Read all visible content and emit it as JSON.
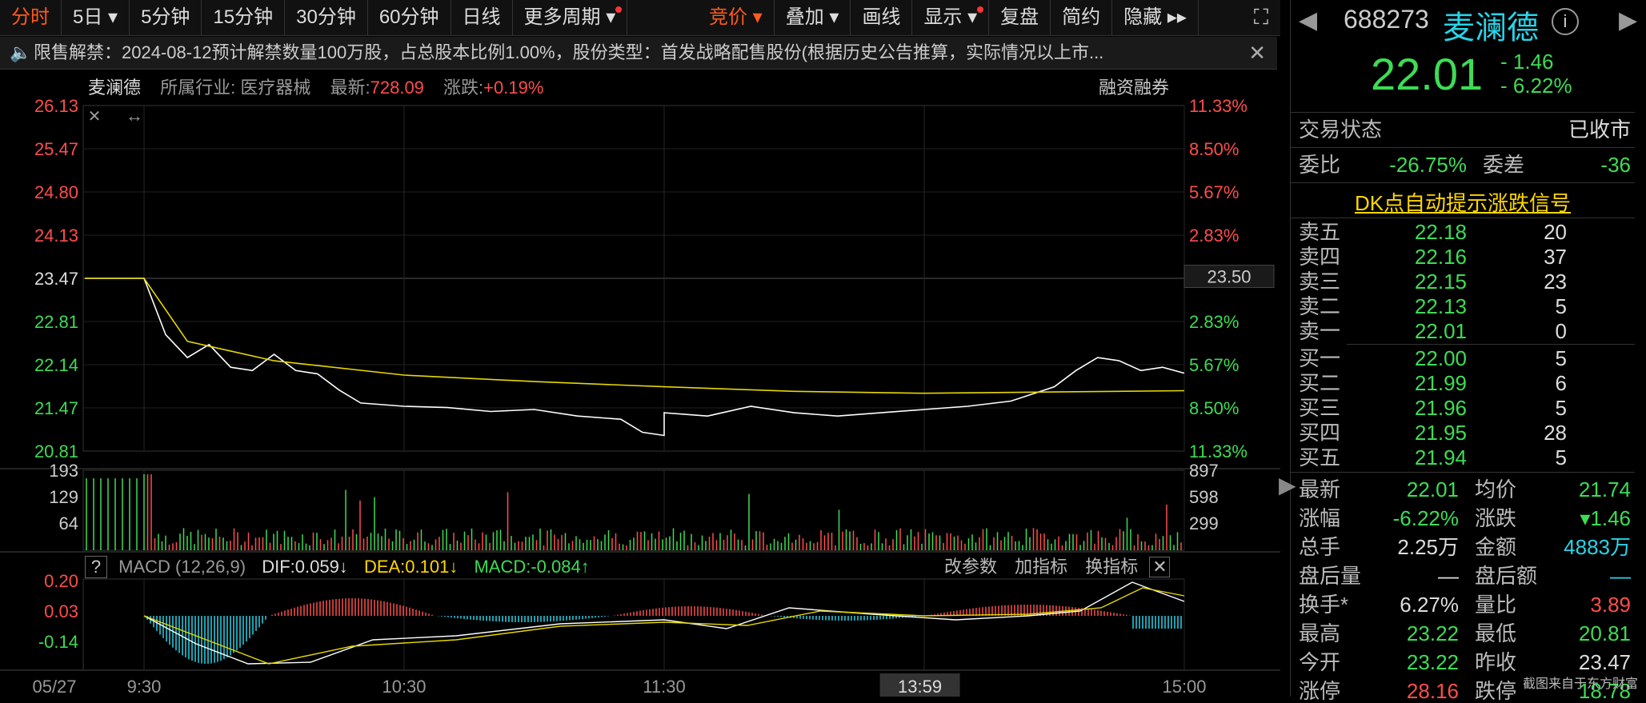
{
  "toolbar": {
    "left": [
      {
        "label": "分时",
        "active": true
      },
      {
        "label": "5日 ▾"
      },
      {
        "label": "5分钟"
      },
      {
        "label": "15分钟"
      },
      {
        "label": "30分钟"
      },
      {
        "label": "60分钟"
      },
      {
        "label": "日线"
      },
      {
        "label": "更多周期 ▾",
        "dot": true
      }
    ],
    "right": [
      {
        "label": "竞价 ▾",
        "active": true
      },
      {
        "label": "叠加 ▾"
      },
      {
        "label": "画线"
      },
      {
        "label": "显示 ▾",
        "dot": true
      },
      {
        "label": "复盘"
      },
      {
        "label": "简约"
      },
      {
        "label": "隐藏 ▸▸"
      }
    ]
  },
  "notice": {
    "text": "限售解禁：2024-08-12预计解禁数量100万股，占总股本比例1.00%，股份类型：首发战略配售股份(根据历史公告推算，实际情况以上市..."
  },
  "info": {
    "name": "麦澜德",
    "industry": "所属行业: 医疗器械",
    "latest_label": "最新:",
    "latest_value": "728.09",
    "change_label": "涨跌:",
    "change_value": "+0.19%",
    "margin": "融资融券"
  },
  "price_axis": {
    "left": [
      "26.13",
      "25.47",
      "24.80",
      "24.13",
      "23.47",
      "22.81",
      "22.14",
      "21.47",
      "20.81"
    ],
    "right": [
      "11.33%",
      "8.50%",
      "5.67%",
      "2.83%",
      "0.00%",
      "2.83%",
      "5.67%",
      "8.50%",
      "11.33%"
    ],
    "cursor_price": "23.50"
  },
  "volume_axis": {
    "left": [
      "193",
      "129",
      "64"
    ],
    "right": [
      "897",
      "598",
      "299"
    ]
  },
  "macd": {
    "help": "?",
    "name": "MACD (12,26,9)",
    "dif": "DIF:0.059↓",
    "dea": "DEA:0.101↓",
    "macd": "MACD:-0.084↑",
    "buttons": [
      "改参数",
      "加指标",
      "换指标"
    ],
    "axis": [
      "0.20",
      "0.03",
      "-0.14"
    ]
  },
  "time_axis": {
    "labels": [
      "05/27",
      "9:30",
      "10:30",
      "11:30",
      "14",
      "15:00"
    ],
    "cursor_time": "13:59"
  },
  "chart_data": {
    "type": "line",
    "title": "",
    "prev_close": 23.47,
    "ylim": [
      20.81,
      26.13
    ],
    "series": [
      {
        "name": "",
        "color": "#ffffff",
        "x": [
          "09:30",
          "09:35",
          "09:40",
          "09:45",
          "09:50",
          "09:55",
          "10:00",
          "10:05",
          "10:10",
          "10:15",
          "10:20",
          "10:30",
          "10:40",
          "10:50",
          "11:00",
          "11:10",
          "11:20",
          "11:25",
          "11:30",
          "13:00",
          "13:10",
          "13:20",
          "13:30",
          "13:40",
          "13:50",
          "14:00",
          "14:10",
          "14:20",
          "14:30",
          "14:35",
          "14:40",
          "14:45",
          "14:50",
          "14:55",
          "15:00"
        ],
        "values": [
          23.47,
          22.6,
          22.25,
          22.45,
          22.1,
          22.05,
          22.3,
          22.05,
          22.0,
          21.75,
          21.55,
          21.5,
          21.48,
          21.42,
          21.45,
          21.35,
          21.3,
          21.1,
          21.05,
          21.4,
          21.35,
          21.5,
          21.4,
          21.35,
          21.4,
          21.45,
          21.5,
          21.58,
          21.8,
          22.05,
          22.25,
          22.2,
          22.05,
          22.1,
          22.01
        ]
      },
      {
        "name": "",
        "color": "#e5d800",
        "x": [
          "09:30",
          "09:40",
          "10:00",
          "10:30",
          "11:00",
          "11:30",
          "13:30",
          "14:00",
          "14:30",
          "15:00"
        ],
        "values": [
          23.47,
          22.5,
          22.2,
          21.98,
          21.88,
          21.8,
          21.73,
          21.7,
          21.72,
          21.74
        ]
      }
    ]
  },
  "quote": {
    "code": "688273",
    "name": "麦澜德",
    "price": "22.01",
    "change": "- 1.46",
    "change_pct": "- 6.22%",
    "trade_status_label": "交易状态",
    "trade_status": "已收市",
    "ratio_label": "委比",
    "ratio": "-26.75%",
    "diff_label": "委差",
    "diff": "-36",
    "dk_link": "DK点自动提示涨跌信号",
    "asks": [
      {
        "label": "卖五",
        "price": "22.18",
        "vol": "20"
      },
      {
        "label": "卖四",
        "price": "22.16",
        "vol": "37"
      },
      {
        "label": "卖三",
        "price": "22.15",
        "vol": "23"
      },
      {
        "label": "卖二",
        "price": "22.13",
        "vol": "5"
      },
      {
        "label": "卖一",
        "price": "22.01",
        "vol": "0"
      }
    ],
    "bids": [
      {
        "label": "买一",
        "price": "22.00",
        "vol": "5"
      },
      {
        "label": "买二",
        "price": "21.99",
        "vol": "6"
      },
      {
        "label": "买三",
        "price": "21.96",
        "vol": "5"
      },
      {
        "label": "买四",
        "price": "21.95",
        "vol": "28"
      },
      {
        "label": "买五",
        "price": "21.94",
        "vol": "5"
      }
    ],
    "stats": [
      {
        "l1": "最新",
        "v1": "22.01",
        "c1": "green",
        "l2": "均价",
        "v2": "21.74",
        "c2": "green"
      },
      {
        "l1": "涨幅",
        "v1": "-6.22%",
        "c1": "green",
        "l2": "涨跌",
        "v2": "▾1.46",
        "c2": "green"
      },
      {
        "l1": "总手",
        "v1": "2.25万",
        "c1": "white",
        "l2": "金额",
        "v2": "4883万",
        "c2": "cyan"
      },
      {
        "l1": "盘后量",
        "v1": "—",
        "c1": "white",
        "l2": "盘后额",
        "v2": "—",
        "c2": "cyan"
      },
      {
        "l1": "换手*",
        "v1": "6.27%",
        "c1": "white",
        "l2": "量比",
        "v2": "3.89",
        "c2": "red"
      },
      {
        "l1": "最高",
        "v1": "23.22",
        "c1": "green",
        "l2": "最低",
        "v2": "20.81",
        "c2": "green"
      },
      {
        "l1": "今开",
        "v1": "23.22",
        "c1": "green",
        "l2": "昨收",
        "v2": "23.47",
        "c2": "white"
      },
      {
        "l1": "涨停",
        "v1": "28.16",
        "c1": "red",
        "l2": "跌停",
        "v2": "18.78",
        "c2": "green"
      }
    ],
    "footer": "截图来自于东方财富"
  }
}
